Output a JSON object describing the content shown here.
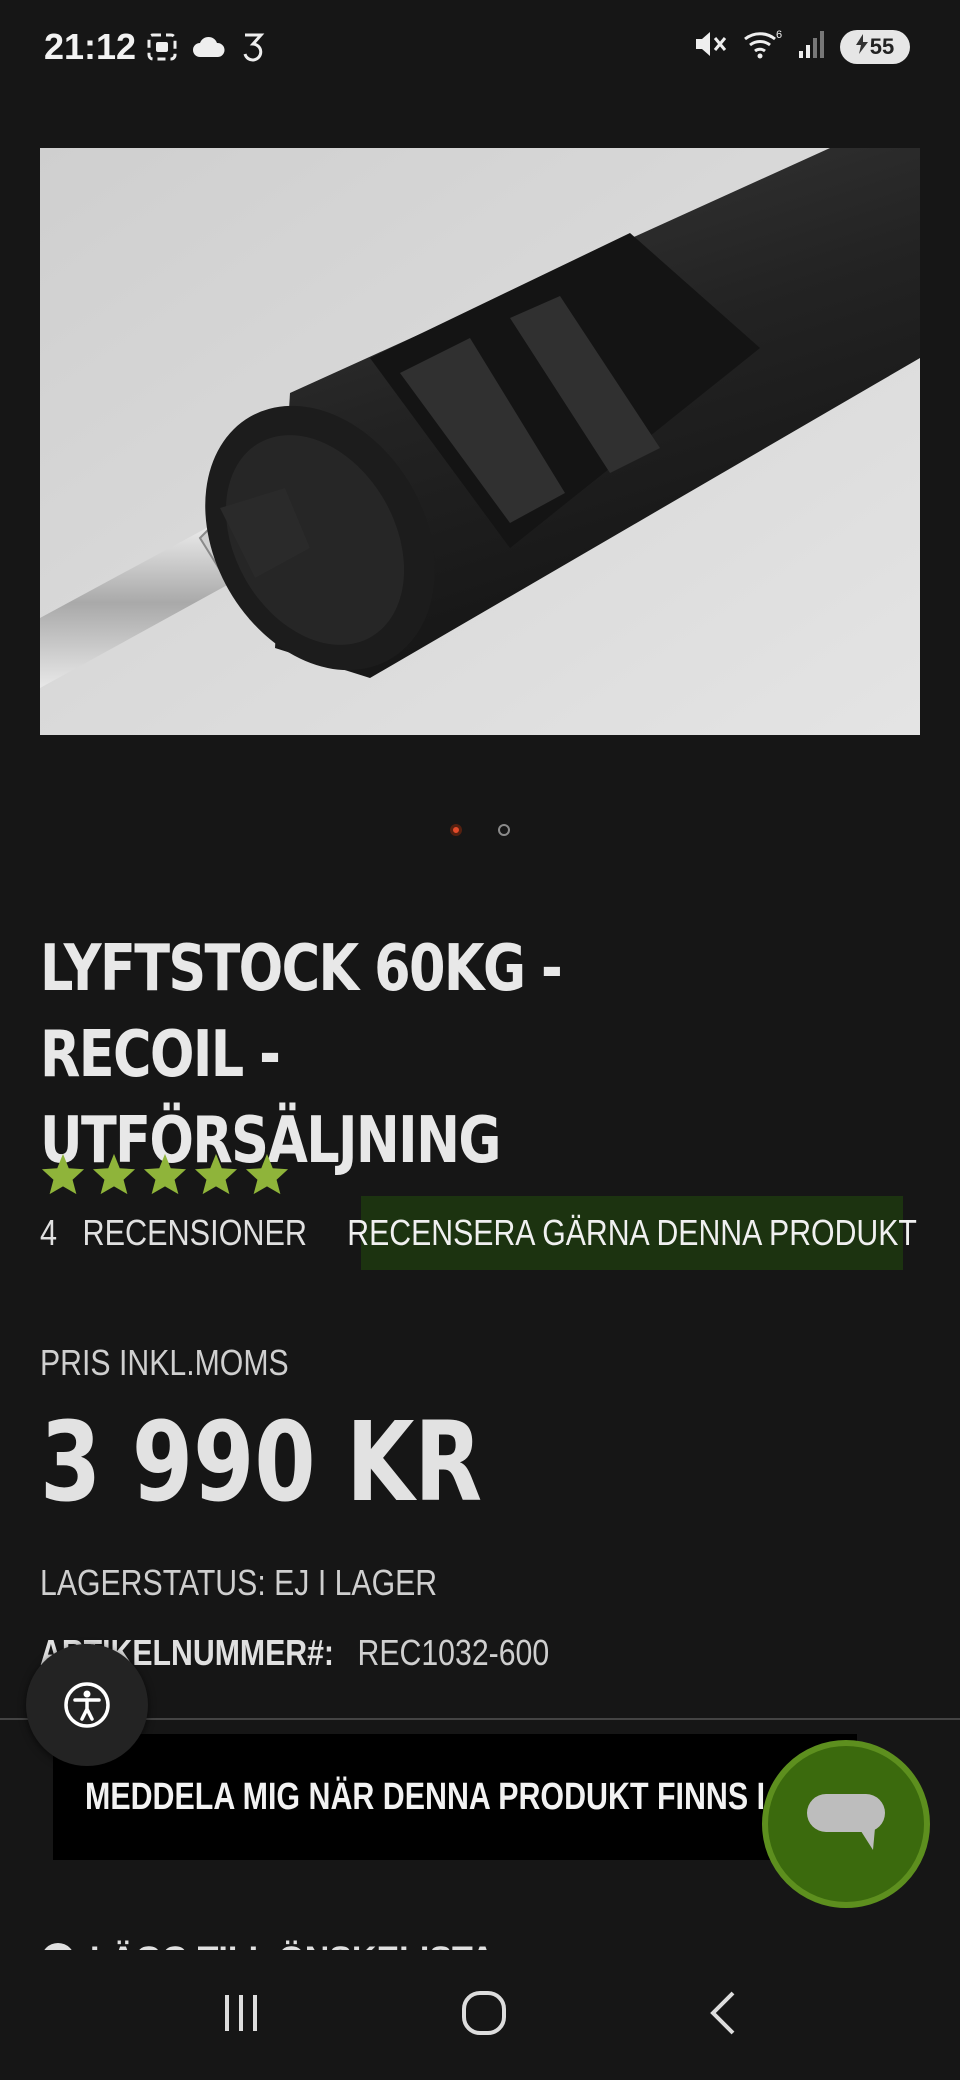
{
  "status_bar": {
    "time": "21:12",
    "left_icons": [
      "screenshot-icon",
      "cloud-icon",
      "carrier-3-icon"
    ],
    "right_icons": [
      "mute-icon",
      "wifi-icon",
      "signal-icon"
    ],
    "wifi_label": "6",
    "battery": "55"
  },
  "product": {
    "image_alt": "barbell-sleeve-photo",
    "carousel": {
      "count": 2,
      "active": 0
    },
    "title_line1": "LYFTSTOCK 60KG - RECOIL -",
    "title_line2": "UTFÖRSÄLJNING",
    "rating": {
      "stars": 5,
      "max": 5,
      "color": "#8fb43a"
    },
    "reviews_count": "4",
    "reviews_label": "RECENSIONER",
    "review_button": "RECENSERA GÄRNA DENNA PRODUKT",
    "price_label": "PRIS INKL.MOMS",
    "price": "3 990 KR",
    "stock_status": "LAGERSTATUS: EJ I LAGER",
    "sku_label": "ARTIKELNUMMER#:",
    "sku_value": "REC1032-600",
    "notify_button": "MEDDELA MIG NÄR DENNA PRODUKT FINNS I LAGER",
    "wishlist_label": "LÄGG TILL ÖNSKELISTA"
  },
  "colors": {
    "background": "#161616",
    "review_button_bg": "#1c3310",
    "chat_button": "#3b6a0d",
    "active_dot": "#e24a2a"
  },
  "floating": {
    "accessibility_icon": "accessibility-icon",
    "chat_icon": "chat-bubble-icon"
  },
  "nav_bar": [
    "recent-apps-icon",
    "home-icon",
    "back-icon"
  ]
}
